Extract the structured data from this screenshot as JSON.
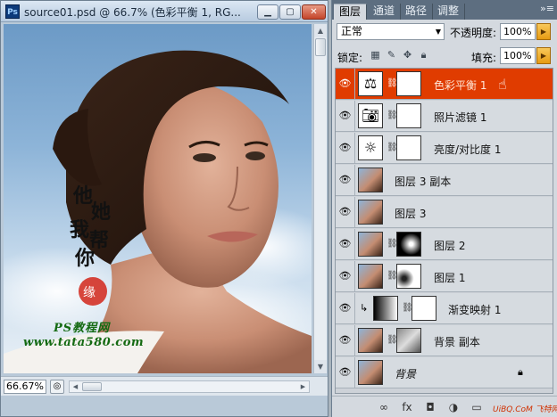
{
  "document": {
    "title": "source01.psd @ 66.7% (色彩平衡 1, RG...",
    "app_icon": "Ps",
    "zoom": "66.67%",
    "canvas_watermark_line1": "PS教程网",
    "canvas_watermark_line2": "www.tata580.com",
    "calligraphy": "他她我帮你"
  },
  "panel": {
    "tabs": [
      {
        "label": "图层"
      },
      {
        "label": "通道"
      },
      {
        "label": "路径"
      },
      {
        "label": "调整"
      }
    ],
    "menu_icon": "»≡",
    "blend_mode": "正常",
    "opacity_label": "不透明度:",
    "opacity_value": "100%",
    "lock_label": "锁定:",
    "fill_label": "填充:",
    "fill_value": "100%",
    "layers": [
      {
        "name": "色彩平衡 1",
        "selected": true,
        "thumb": "balance-icon",
        "has_mask": true
      },
      {
        "name": "照片滤镜 1",
        "selected": false,
        "thumb": "camera-icon",
        "has_mask": true
      },
      {
        "name": "亮度/对比度 1",
        "selected": false,
        "thumb": "brightness-icon",
        "has_mask": true
      },
      {
        "name": "图层 3 副本",
        "selected": false,
        "thumb": "photo"
      },
      {
        "name": "图层 3",
        "selected": false,
        "thumb": "photo"
      },
      {
        "name": "图层 2",
        "selected": false,
        "thumb": "photo",
        "has_mask": true
      },
      {
        "name": "图层 1",
        "selected": false,
        "thumb": "photo",
        "has_mask": true
      },
      {
        "name": "渐变映射 1",
        "selected": false,
        "thumb": "gradient",
        "has_mask": true,
        "clipped": true
      },
      {
        "name": "背景 副本",
        "selected": false,
        "thumb": "photo",
        "has_mask": true
      },
      {
        "name": "背景",
        "selected": false,
        "thumb": "photo",
        "locked": true
      }
    ],
    "footer_watermark": "UiBQ.CoM 飞特网"
  },
  "colors": {
    "selected_layer": "#e03c00",
    "panel_bg": "#d4d9df",
    "sky": "#8db4d8"
  }
}
